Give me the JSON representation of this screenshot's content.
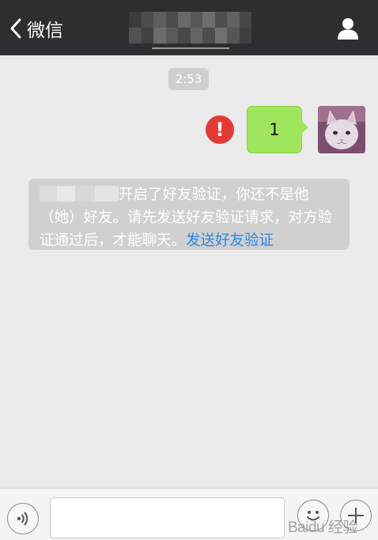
{
  "header": {
    "back_label": "微信",
    "title_redacted": true
  },
  "chat": {
    "timestamp": "2:53",
    "sent_message": "1",
    "send_failed": true,
    "system_notice": {
      "text_line1": "开启了好友验证，你还不是他",
      "text_rest": "（她）好友。请先发送好友验证请求，对方验证通过后，才能聊天。",
      "link_text": "发送好友验证"
    }
  },
  "input_bar": {
    "message_value": "",
    "watermark_text": "Baidu 经验"
  },
  "icons": {
    "back": "chevron-left-icon",
    "profile": "person-icon",
    "error": "exclamation-icon",
    "voice": "voice-icon",
    "emoji": "emoji-icon",
    "plus": "plus-icon"
  },
  "colors": {
    "titlebar": "#2c2e31",
    "background": "#ebebeb",
    "sent_bubble": "#9fe65c",
    "error": "#e53935",
    "link": "#2a88e0",
    "system_notice_bg": "#d0d0d0"
  }
}
